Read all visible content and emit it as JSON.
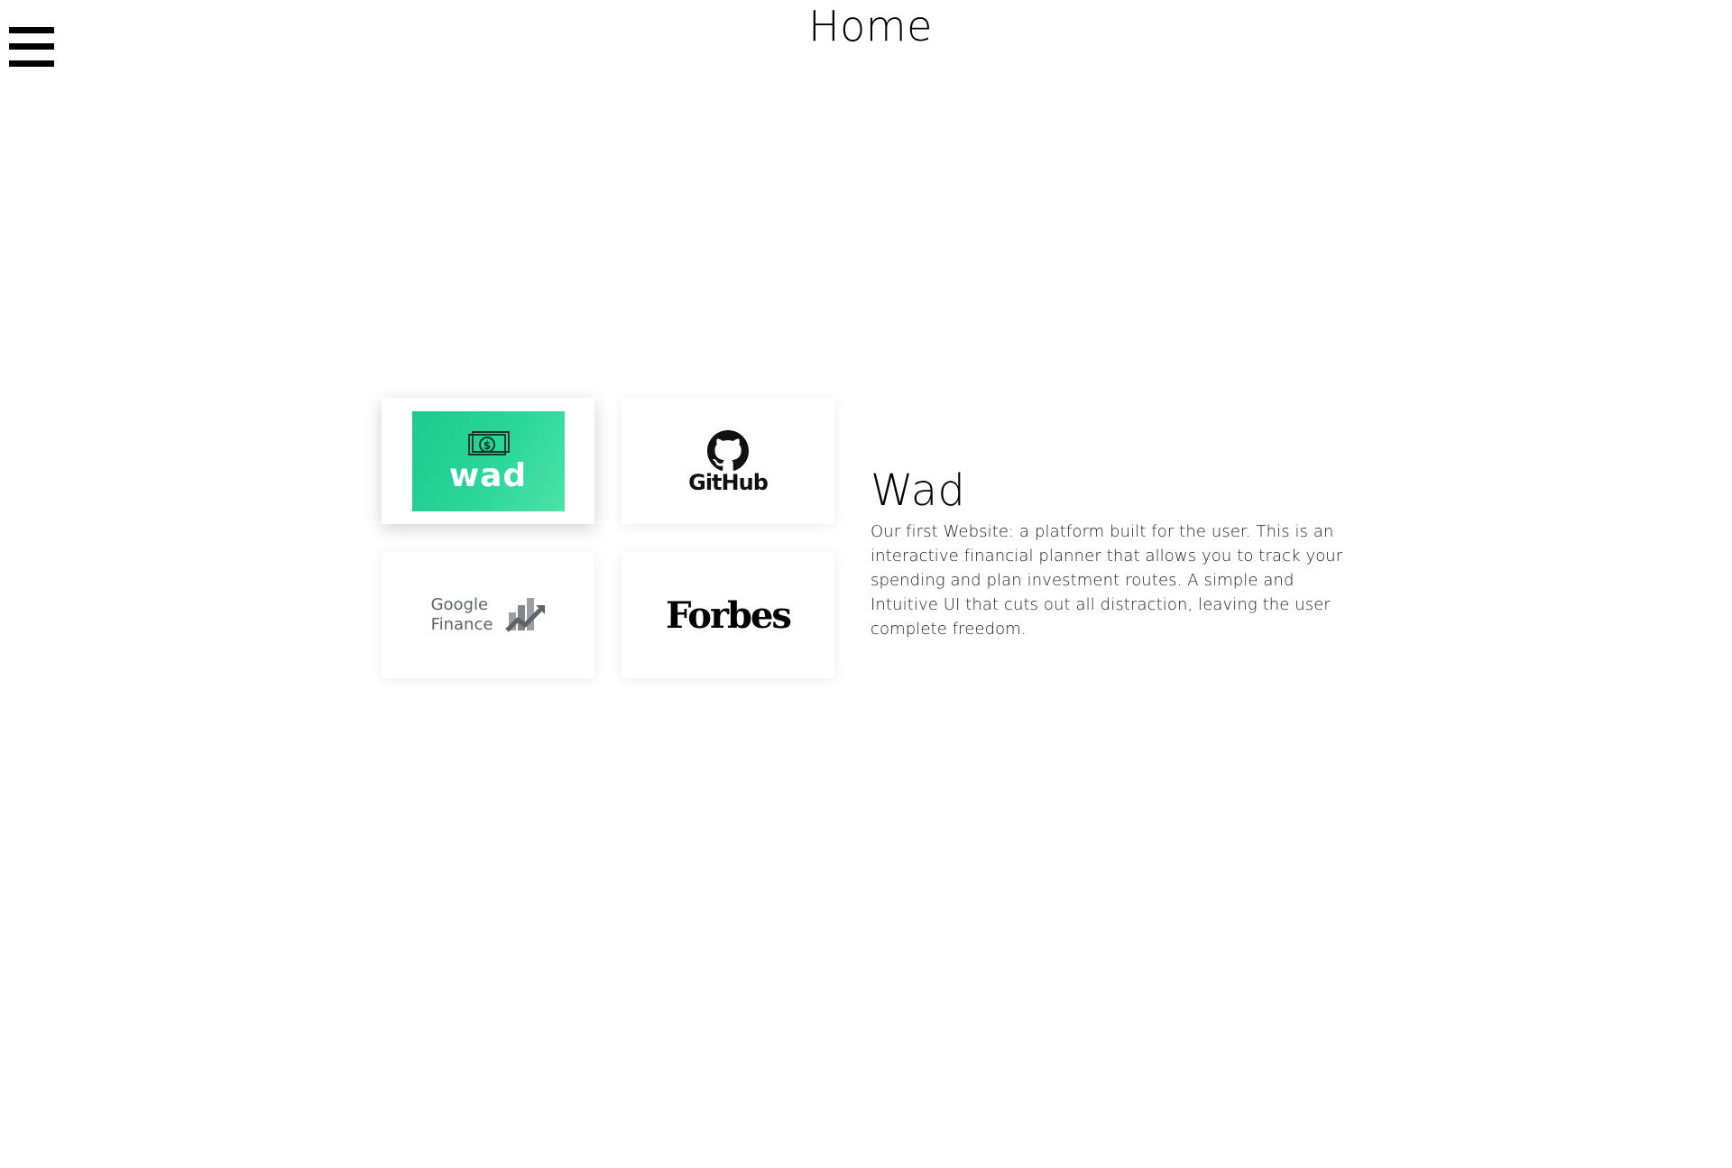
{
  "header": {
    "title": "Home",
    "menu_icon": "hamburger-menu-icon"
  },
  "cards": [
    {
      "id": "wad",
      "logo_text": "wad",
      "icon": "dollar-bill-icon",
      "brand_color": "#2bd79a",
      "active": true
    },
    {
      "id": "github",
      "logo_text": "GitHub",
      "icon": "octocat-icon"
    },
    {
      "id": "google-finance",
      "logo_text_line1": "Google",
      "logo_text_line2": "Finance",
      "icon": "finance-chart-icon"
    },
    {
      "id": "forbes",
      "logo_text": "Forbes"
    }
  ],
  "detail": {
    "title": "Wad",
    "description": "Our first Website: a platform built for the user. This is an interactive financial planner that allows you to track your spending and plan investment routes. A simple and Intuitive UI that cuts out all distraction, leaving the user complete freedom."
  }
}
